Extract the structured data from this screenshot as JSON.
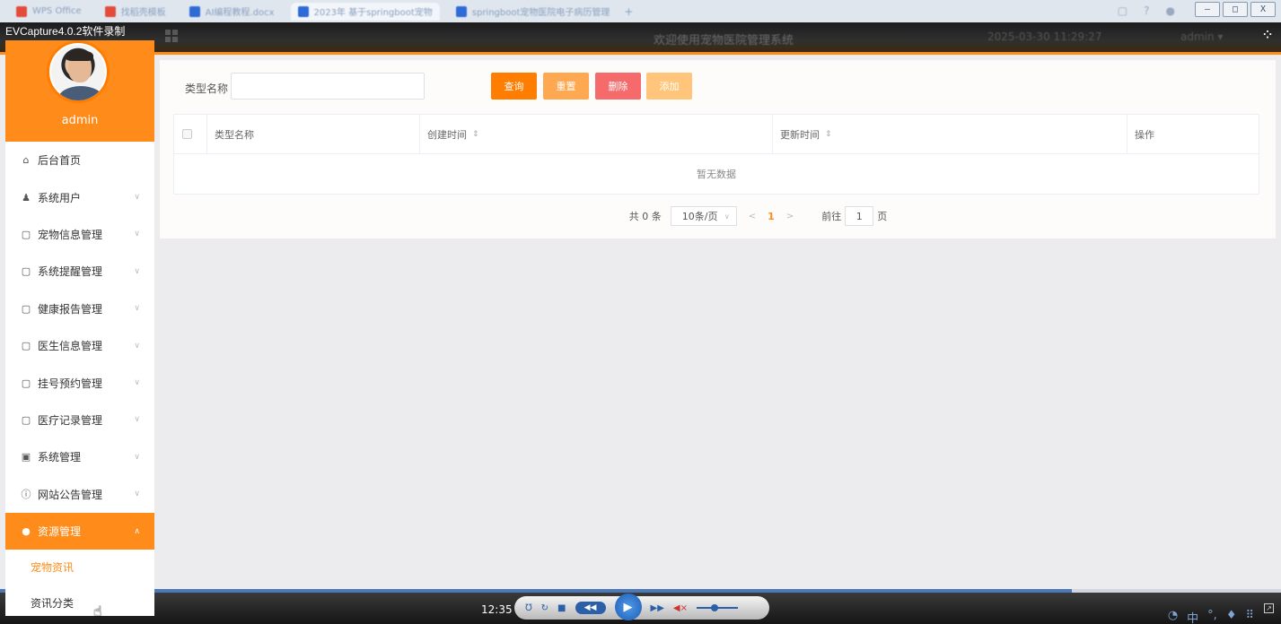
{
  "browser": {
    "tabs": [
      {
        "label": "WPS Office",
        "color": "#e34b3a"
      },
      {
        "label": "找稻壳模板",
        "color": "#e34b3a"
      },
      {
        "label": "AI编程教程.docx",
        "color": "#2f6bd6"
      },
      {
        "label": "2023年 基于springboot宠物",
        "color": "#2f6bd6"
      },
      {
        "label": "springboot宠物医院电子病历管理",
        "color": "#2f6bd6"
      }
    ],
    "window_buttons": [
      "—",
      "□",
      "X"
    ]
  },
  "recorder": {
    "title": "EVCapture4.0.2软件录制"
  },
  "header": {
    "welcome": "欢迎使用宠物医院管理系统",
    "datetime": "2025-03-30 11:29:27",
    "user": "admin",
    "corner_icon": "fullscreen-icon"
  },
  "sidebar": {
    "username": "admin",
    "items": [
      {
        "label": "后台首页",
        "icon": "home-icon",
        "glyph": "⌂",
        "has_chevron": false
      },
      {
        "label": "系统用户",
        "icon": "user-icon",
        "glyph": "♟",
        "has_chevron": true
      },
      {
        "label": "宠物信息管理",
        "icon": "doc-icon",
        "glyph": "▢",
        "has_chevron": true
      },
      {
        "label": "系统提醒管理",
        "icon": "doc-icon",
        "glyph": "▢",
        "has_chevron": true
      },
      {
        "label": "健康报告管理",
        "icon": "doc-icon",
        "glyph": "▢",
        "has_chevron": true
      },
      {
        "label": "医生信息管理",
        "icon": "doc-icon",
        "glyph": "▢",
        "has_chevron": true
      },
      {
        "label": "挂号预约管理",
        "icon": "doc-icon",
        "glyph": "▢",
        "has_chevron": true
      },
      {
        "label": "医疗记录管理",
        "icon": "doc-icon",
        "glyph": "▢",
        "has_chevron": true
      },
      {
        "label": "系统管理",
        "icon": "picture-icon",
        "glyph": "▣",
        "has_chevron": true
      },
      {
        "label": "网站公告管理",
        "icon": "info-icon",
        "glyph": "ⓘ",
        "has_chevron": true
      },
      {
        "label": "资源管理",
        "icon": "bulb-icon",
        "glyph": "●",
        "has_chevron": true,
        "active": true
      }
    ],
    "subitems": [
      {
        "label": "宠物资讯",
        "active": true
      },
      {
        "label": "资讯分类",
        "active": false
      }
    ]
  },
  "search": {
    "label": "类型名称",
    "placeholder": "",
    "buttons": {
      "query": "查询",
      "reset": "重置",
      "delete": "删除",
      "add": "添加"
    }
  },
  "table": {
    "columns": [
      {
        "label": "类型名称",
        "sortable": false
      },
      {
        "label": "创建时间",
        "sortable": true
      },
      {
        "label": "更新时间",
        "sortable": true
      },
      {
        "label": "操作",
        "sortable": false
      }
    ],
    "empty_text": "暂无数据"
  },
  "pagination": {
    "total_text": "共 0 条",
    "page_size": "10条/页",
    "current_page": "1",
    "goto_label": "前往",
    "goto_value": "1",
    "page_suffix": "页"
  },
  "player": {
    "time": "12:35",
    "progress": 0.837
  },
  "colors": {
    "accent": "#ff8c1a",
    "danger": "#f56b6b"
  }
}
